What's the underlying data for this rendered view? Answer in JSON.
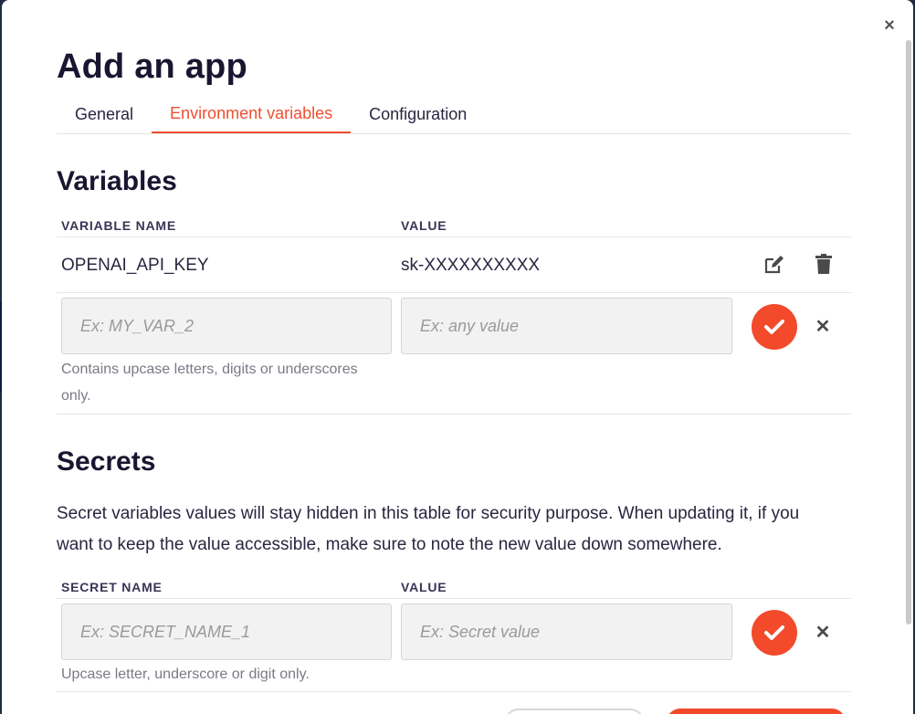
{
  "modal": {
    "title": "Add an app",
    "close_label": "×"
  },
  "tabs": [
    {
      "label": "General",
      "active": false
    },
    {
      "label": "Environment variables",
      "active": true
    },
    {
      "label": "Configuration",
      "active": false
    }
  ],
  "variables": {
    "heading": "Variables",
    "col_name": "VARIABLE NAME",
    "col_value": "VALUE",
    "rows": [
      {
        "name": "OPENAI_API_KEY",
        "value": "sk-XXXXXXXXXX"
      }
    ],
    "new_name_placeholder": "Ex: MY_VAR_2",
    "new_value_placeholder": "Ex: any value",
    "hint_line1": "Contains upcase letters, digits or underscores",
    "hint_line2": "only."
  },
  "secrets": {
    "heading": "Secrets",
    "description_line1": "Secret variables values will stay hidden in this table for security purpose. When updating it, if you",
    "description_line2": "want to keep the value accessible, make sure to note the new value down somewhere.",
    "col_name": "SECRET NAME",
    "col_value": "VALUE",
    "new_name_placeholder": "Ex: SECRET_NAME_1",
    "new_value_placeholder": "Ex: Secret value",
    "hint": "Upcase letter, underscore or digit only."
  },
  "colors": {
    "accent": "#f04e30",
    "confirm_button": "#f24a2b",
    "text": "#2a2540"
  },
  "icons": {
    "edit": "pencil-square-icon",
    "delete": "trash-icon",
    "confirm": "checkmark-icon",
    "cancel": "close-icon"
  }
}
